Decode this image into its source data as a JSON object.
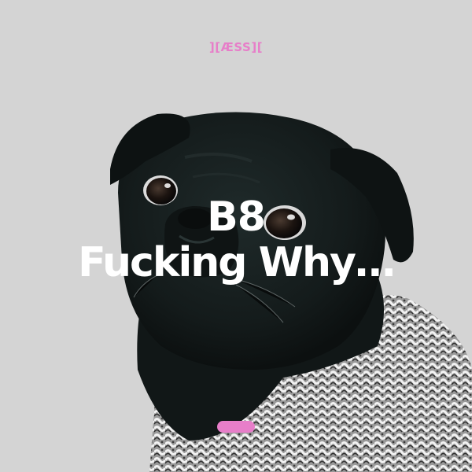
{
  "logo": {
    "text": "][ÆSS][",
    "color": "#e77ec9"
  },
  "headline": {
    "line1": "B8",
    "line2": "Fucking Why…"
  },
  "pill": {
    "color": "#e77ec9"
  },
  "background": {
    "color": "#d4d4d4"
  },
  "image": {
    "subject": "pug-in-knit-sweater"
  }
}
